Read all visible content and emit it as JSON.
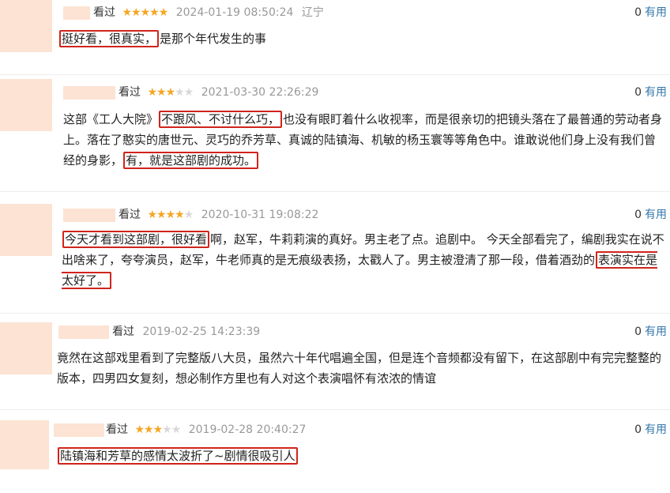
{
  "useful_label": "有用",
  "watched_label": "看过",
  "reviews": [
    {
      "stars": 5,
      "date": "2024-01-19 08:50:24",
      "location": "辽宁",
      "useful_count": "0",
      "parts": [
        {
          "text": "挺好看，很真实，",
          "highlight": true
        },
        {
          "text": "是那个年代发生的事",
          "highlight": false
        }
      ]
    },
    {
      "stars": 3,
      "date": "2021-03-30 22:26:29",
      "location": "",
      "useful_count": "0",
      "parts": [
        {
          "text": "这部《工人大院》",
          "highlight": false
        },
        {
          "text": "不跟风、不讨什么巧，",
          "highlight": true
        },
        {
          "text": "也没有眼盯着什么收视率，而是很亲切的把镜头落在了最普通的劳动者身上。落在了憨实的唐世元、灵巧的乔芳草、真诚的陆镇海、机敏的杨玉寰等等角色中。谁敢说他们身上没有我们曾经的身影，",
          "highlight": false
        },
        {
          "text": "有，就是这部剧的成功。",
          "highlight": true
        }
      ]
    },
    {
      "stars": 4,
      "date": "2020-10-31 19:08:22",
      "location": "",
      "useful_count": "0",
      "parts": [
        {
          "text": "今天才看到这部剧，很好看",
          "highlight": true
        },
        {
          "text": "啊，赵军，牛莉莉演的真好。男主老了点。追剧中。 今天全部看完了，编剧我实在说不出啥来了，夸夸演员，赵军，牛老师真的是无痕级表扬，太戳人了。男主被澄清了那一段，借着酒劲的",
          "highlight": false
        },
        {
          "text": "表演实在是太好了。",
          "highlight": true
        }
      ]
    },
    {
      "stars": 0,
      "date": "2019-02-25 14:23:39",
      "location": "",
      "useful_count": "0",
      "parts": [
        {
          "text": "竟然在这部戏里看到了完整版八大员，虽然六十年代唱遍全国，但是连个音频都没有留下，在这部剧中有完完整整的版本，四男四女复刻，想必制作方里也有人对这个表演唱怀有浓浓的情谊",
          "highlight": false
        }
      ]
    },
    {
      "stars": 3,
      "date": "2019-02-28 20:40:27",
      "location": "",
      "useful_count": "0",
      "parts": [
        {
          "text": "陆镇海和芳草的感情太波折了~剧情很吸引人",
          "highlight": true
        }
      ]
    }
  ],
  "colors": {
    "star": "#f5a623",
    "star_empty": "#d8d8d8",
    "link": "#3377aa",
    "highlight_border": "#d0241c",
    "placeholder": "#fce3d3"
  }
}
